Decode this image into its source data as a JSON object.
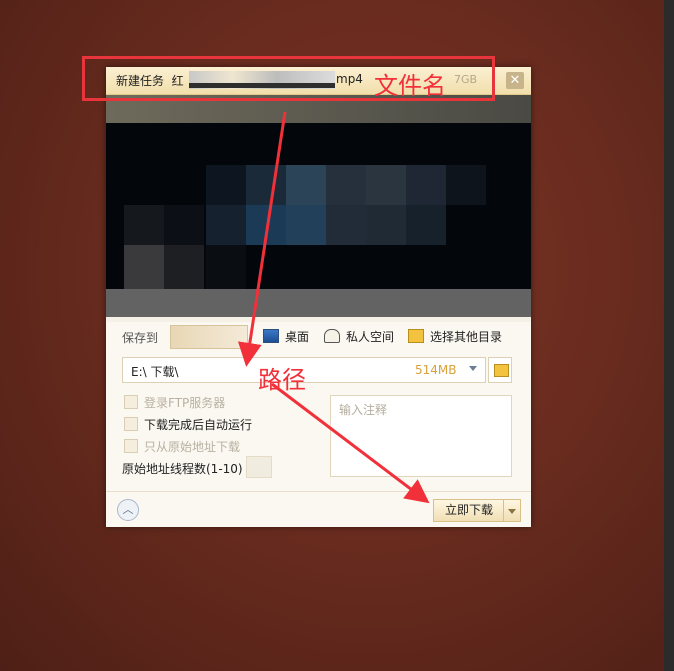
{
  "dialog": {
    "title_prefix": "新建任务",
    "file_name_visible": "红",
    "file_ext": "mp4",
    "size_hint": "7GB",
    "close_glyph": "✕",
    "save_to_label": "保存到",
    "desktop_label": "桌面",
    "private_label": "私人空间",
    "other_dir_label": "选择其他目录",
    "path_value": "E:\\       下载\\",
    "free_space": "514MB",
    "checkbox_ftp": "登录FTP服务器",
    "checkbox_autorun": "下载完成后自动运行",
    "checkbox_origin": "只从原始地址下载",
    "threads_label": "原始地址线程数(1-10)",
    "note_placeholder": "输入注释",
    "download_now": "立即下载"
  },
  "annotations": {
    "filename": "文件名",
    "path": "路径"
  },
  "colors": {
    "annotation_red": "#f2303a",
    "titlebar": "#f1deab",
    "free_space": "#d9a13a"
  }
}
